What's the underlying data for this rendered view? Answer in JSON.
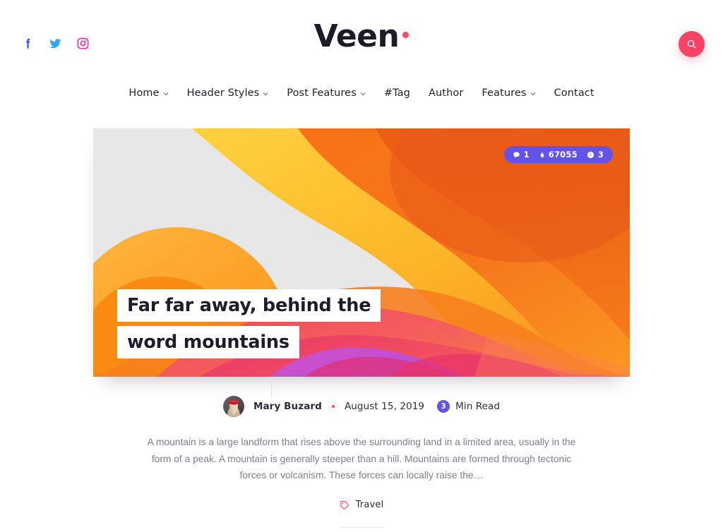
{
  "site": {
    "brand_name": "Veen",
    "brand_dot": "dot"
  },
  "social": [
    {
      "name": "facebook",
      "label": "Facebook",
      "color": "#2d4dd4"
    },
    {
      "name": "twitter",
      "label": "Twitter",
      "color": "#2ca8f0"
    },
    {
      "name": "instagram",
      "label": "Instagram",
      "color": "#ea2ba0"
    }
  ],
  "search": {
    "icon": "search-icon",
    "label": "Search",
    "color": "#fb4364"
  },
  "nav": {
    "items": [
      {
        "label": "Home",
        "has_dropdown": true
      },
      {
        "label": "Header Styles",
        "has_dropdown": true
      },
      {
        "label": "Post Features",
        "has_dropdown": true
      },
      {
        "label": "#Tag",
        "has_dropdown": false
      },
      {
        "label": "Author",
        "has_dropdown": false
      },
      {
        "label": "Features",
        "has_dropdown": true
      },
      {
        "label": "Contact",
        "has_dropdown": false
      }
    ]
  },
  "post": {
    "title_line_1": "Far far away, behind the word",
    "title_line_2": "mountains",
    "title_full": "Far far away, behind the word mountains",
    "stats": {
      "comments_icon": "comment-icon",
      "comments": "1",
      "views_icon": "flame-icon",
      "views": "67055",
      "time_icon": "clock-icon",
      "time": "3"
    },
    "meta": {
      "author": "Mary Buzard",
      "separator": "•",
      "date": "August 15, 2019",
      "read_minutes": "3",
      "read_label": "Min Read"
    },
    "excerpt": "A mountain is a large landform that rises above the surrounding land in a limited area, usually in the form of a peak. A mountain is generally steeper than a hill. Mountains are formed through tectonic forces or volcanism. These forces can locally raise the…",
    "tag": {
      "icon": "tag-icon",
      "label": "Travel"
    },
    "accent_colors": {
      "pill": "#6254ea",
      "pink": "#fb4b6b",
      "title_text": "#1c1c2b"
    }
  }
}
